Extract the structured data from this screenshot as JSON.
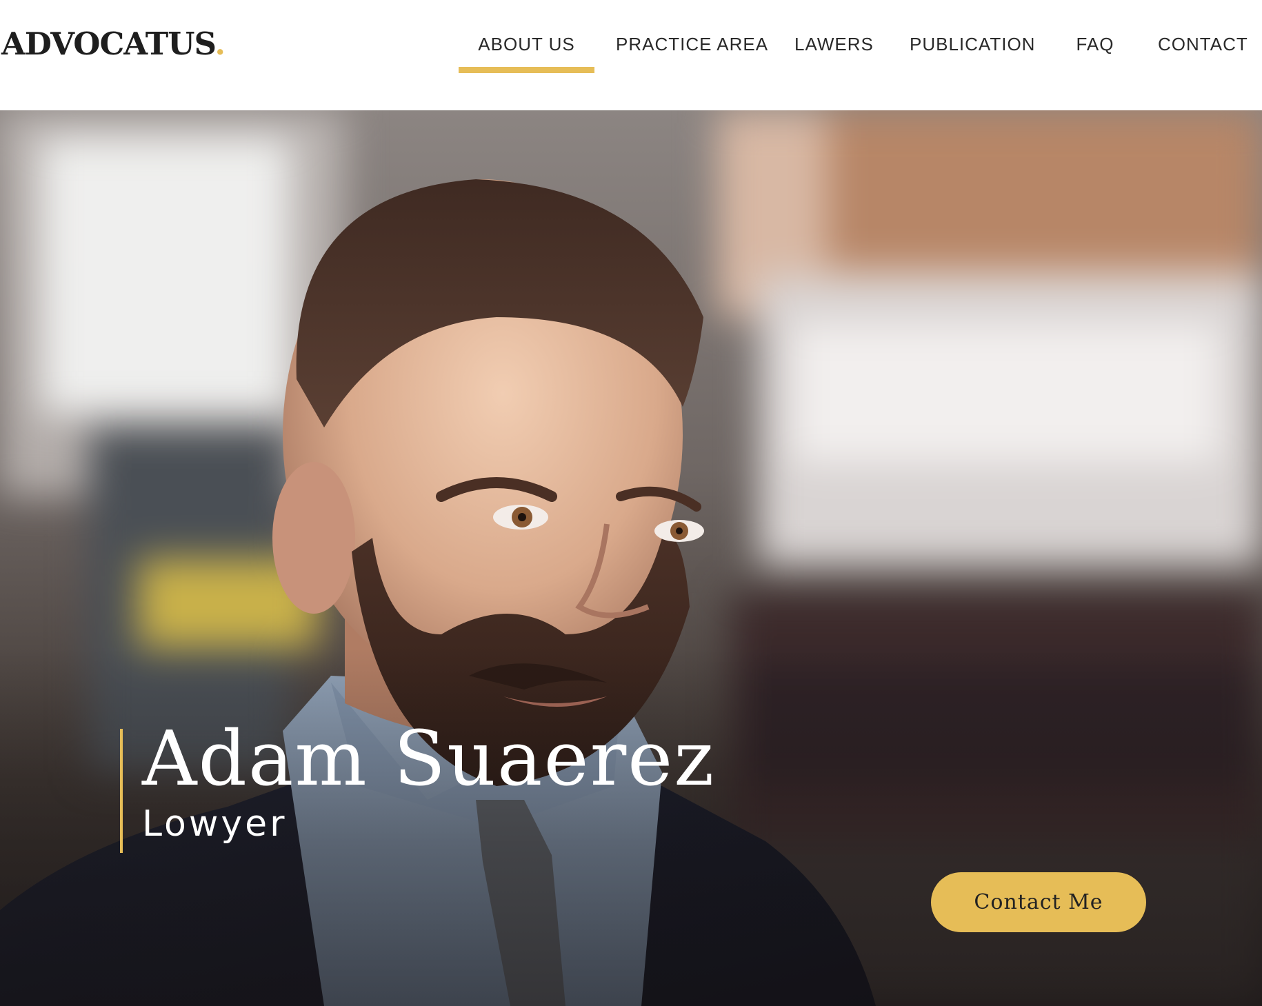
{
  "brand": {
    "logo_text": "ADVOCATUS",
    "logo_dot": ".",
    "accent_color": "#e6bd57"
  },
  "nav": {
    "items": [
      {
        "label": "ABOUT US",
        "active": true
      },
      {
        "label": "PRACTICE AREA",
        "active": false
      },
      {
        "label": "LAWERS",
        "active": false
      },
      {
        "label": "PUBLICATION",
        "active": false
      },
      {
        "label": "FAQ",
        "active": false
      },
      {
        "label": "CONTACT",
        "active": false
      }
    ]
  },
  "hero": {
    "name": "Adam Suaerez",
    "title": "Lowyer",
    "cta_label": "Contact Me"
  }
}
